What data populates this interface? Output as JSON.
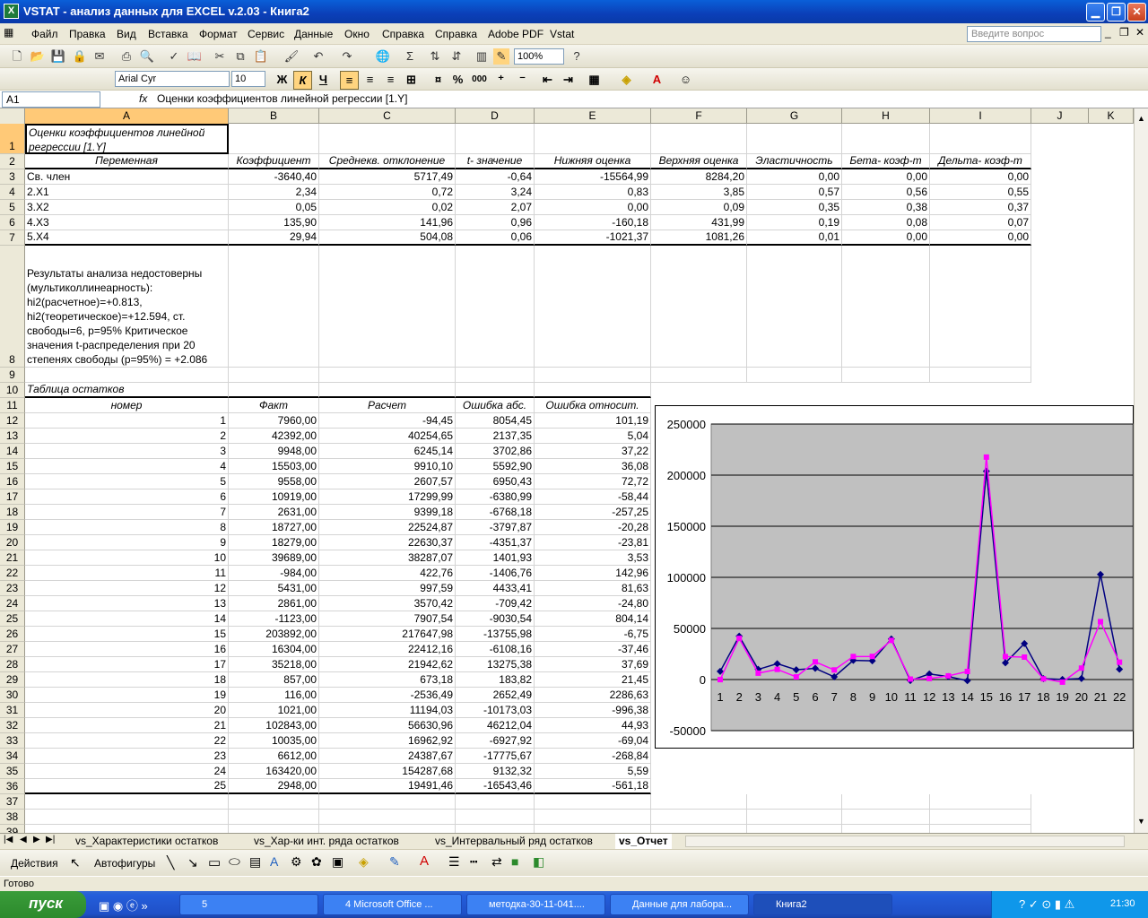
{
  "app": {
    "title": "VSTAT - анализ данных для EXCEL v.2.03 - Книга2"
  },
  "menu": [
    "Файл",
    "Правка",
    "Вид",
    "Вставка",
    "Формат",
    "Сервис",
    "Данные",
    "Окно",
    "Справка",
    "Справка",
    "Adobe PDF",
    "Vstat"
  ],
  "ask_placeholder": "Введите вопрос",
  "toolbar": {
    "zoom": "100%",
    "font": "Arial Cyr",
    "size": "10",
    "bold": "Ж",
    "italic": "К",
    "underline": "Ч",
    "percent": "%",
    "thousands": "000"
  },
  "formula": {
    "cell": "A1",
    "fx": "fx",
    "content": "Оценки коэффициентов линейной регрессии [1.Y]"
  },
  "columns": [
    "A",
    "B",
    "C",
    "D",
    "E",
    "F",
    "G",
    "H",
    "I",
    "J",
    "K"
  ],
  "rows": {
    "r1": "Оценки коэффициентов линейной регрессии [1.Y]",
    "headers": [
      "Переменная",
      "Коэффициент",
      "Среднекв. отклонение",
      "t- значение",
      "Нижняя оценка",
      "Верхняя оценка",
      "Эластичность",
      "Бета- коэф-т",
      "Дельта- коэф-т"
    ],
    "coef": [
      [
        "Св. член",
        "-3640,40",
        "5717,49",
        "-0,64",
        "-15564,99",
        "8284,20",
        "0,00",
        "0,00",
        "0,00"
      ],
      [
        "2.X1",
        "2,34",
        "0,72",
        "3,24",
        "0,83",
        "3,85",
        "0,57",
        "0,56",
        "0,55"
      ],
      [
        "3.X2",
        "0,05",
        "0,02",
        "2,07",
        "0,00",
        "0,09",
        "0,35",
        "0,38",
        "0,37"
      ],
      [
        "4.X3",
        "135,90",
        "141,96",
        "0,96",
        "-160,18",
        "431,99",
        "0,19",
        "0,08",
        "0,07"
      ],
      [
        "5.X4",
        "29,94",
        "504,08",
        "0,06",
        "-1021,37",
        "1081,26",
        "0,01",
        "0,00",
        "0,00"
      ]
    ],
    "note": [
      "Результаты анализа недостоверны",
      "(мультиколлинеарность):",
      "hi2(расчетное)=+0.813,",
      "hi2(теоретическое)=+12.594, ст.",
      "свободы=6, р=95%  Критическое",
      "значения t-распределения при 20",
      "степенях свободы (р=95%) = +2.086"
    ],
    "resid_title": "Таблица остатков",
    "resid_headers": [
      "номер",
      "Факт",
      "Расчет",
      "Ошибка абс.",
      "Ошибка относит."
    ],
    "resid": [
      [
        "1",
        "7960,00",
        "-94,45",
        "8054,45",
        "101,19"
      ],
      [
        "2",
        "42392,00",
        "40254,65",
        "2137,35",
        "5,04"
      ],
      [
        "3",
        "9948,00",
        "6245,14",
        "3702,86",
        "37,22"
      ],
      [
        "4",
        "15503,00",
        "9910,10",
        "5592,90",
        "36,08"
      ],
      [
        "5",
        "9558,00",
        "2607,57",
        "6950,43",
        "72,72"
      ],
      [
        "6",
        "10919,00",
        "17299,99",
        "-6380,99",
        "-58,44"
      ],
      [
        "7",
        "2631,00",
        "9399,18",
        "-6768,18",
        "-257,25"
      ],
      [
        "8",
        "18727,00",
        "22524,87",
        "-3797,87",
        "-20,28"
      ],
      [
        "9",
        "18279,00",
        "22630,37",
        "-4351,37",
        "-23,81"
      ],
      [
        "10",
        "39689,00",
        "38287,07",
        "1401,93",
        "3,53"
      ],
      [
        "11",
        "-984,00",
        "422,76",
        "-1406,76",
        "142,96"
      ],
      [
        "12",
        "5431,00",
        "997,59",
        "4433,41",
        "81,63"
      ],
      [
        "13",
        "2861,00",
        "3570,42",
        "-709,42",
        "-24,80"
      ],
      [
        "14",
        "-1123,00",
        "7907,54",
        "-9030,54",
        "804,14"
      ],
      [
        "15",
        "203892,00",
        "217647,98",
        "-13755,98",
        "-6,75"
      ],
      [
        "16",
        "16304,00",
        "22412,16",
        "-6108,16",
        "-37,46"
      ],
      [
        "17",
        "35218,00",
        "21942,62",
        "13275,38",
        "37,69"
      ],
      [
        "18",
        "857,00",
        "673,18",
        "183,82",
        "21,45"
      ],
      [
        "19",
        "116,00",
        "-2536,49",
        "2652,49",
        "2286,63"
      ],
      [
        "20",
        "1021,00",
        "11194,03",
        "-10173,03",
        "-996,38"
      ],
      [
        "21",
        "102843,00",
        "56630,96",
        "46212,04",
        "44,93"
      ],
      [
        "22",
        "10035,00",
        "16962,92",
        "-6927,92",
        "-69,04"
      ],
      [
        "23",
        "6612,00",
        "24387,67",
        "-17775,67",
        "-268,84"
      ],
      [
        "24",
        "163420,00",
        "154287,68",
        "9132,32",
        "5,59"
      ],
      [
        "25",
        "2948,00",
        "19491,46",
        "-16543,46",
        "-561,18"
      ]
    ]
  },
  "chart_data": {
    "type": "line",
    "x": [
      1,
      2,
      3,
      4,
      5,
      6,
      7,
      8,
      9,
      10,
      11,
      12,
      13,
      14,
      15,
      16,
      17,
      18,
      19,
      20,
      21,
      22
    ],
    "ylim": [
      -50000,
      250000
    ],
    "yticks": [
      "250000",
      "200000",
      "150000",
      "100000",
      "50000",
      "0",
      "-50000"
    ],
    "series": [
      {
        "values": [
          7960,
          42392,
          9948,
          15503,
          9558,
          10919,
          2631,
          18727,
          18279,
          39689,
          -984,
          5431,
          2861,
          -1123,
          203892,
          16304,
          35218,
          857,
          116,
          1021,
          102843,
          10035
        ],
        "color": "#000080"
      },
      {
        "values": [
          -94,
          40255,
          6245,
          9910,
          2608,
          17300,
          9399,
          22525,
          22630,
          38287,
          423,
          998,
          3570,
          7908,
          217648,
          22412,
          21943,
          673,
          -2536,
          11194,
          56631,
          16963
        ],
        "color": "#ff00ff"
      }
    ],
    "plot_bg": "#c0c0c0"
  },
  "tabs": [
    "vs_Характеристики остатков",
    "vs_Хар-ки инт. ряда остатков",
    "vs_Интервальный ряд остатков",
    "vs_Отчет"
  ],
  "draw": {
    "actions": "Действия",
    "autoshapes": "Автофигуры"
  },
  "status": "Готово",
  "taskbar": {
    "start": "пуск",
    "items": [
      "5",
      "4 Microsoft Office ...",
      "методка-30-11-041....",
      "Данные для лабора...",
      "Книга2"
    ],
    "lang": "EN",
    "time": "21:30"
  }
}
